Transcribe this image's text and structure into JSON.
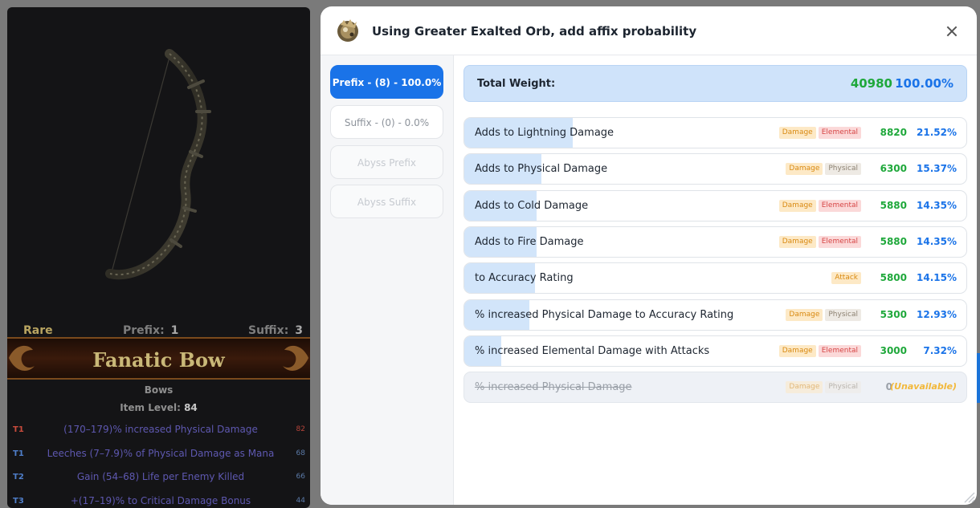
{
  "item": {
    "rarity": "Rare",
    "prefix_label": "Prefix:",
    "prefix_count": "1",
    "suffix_label": "Suffix:",
    "suffix_count": "3",
    "name": "Fanatic Bow",
    "item_class": "Bows",
    "item_level_label": "Item Level:",
    "item_level": "84",
    "mods": [
      {
        "tier": "T1",
        "text": "(170–179)% increased Physical Damage",
        "level": "82",
        "tier_color": "#c94b3c",
        "level_color": "#b5443a"
      },
      {
        "tier": "T1",
        "text": "Leeches (7–7.9)% of Physical Damage as Mana",
        "level": "68",
        "tier_color": "#4f7ec9",
        "level_color": "#5b7aa8"
      },
      {
        "tier": "T2",
        "text": "Gain (54–68) Life per Enemy Killed",
        "level": "66",
        "tier_color": "#4f7ec9",
        "level_color": "#5b7aa8"
      },
      {
        "tier": "T3",
        "text": "+(17–19)% to Critical Damage Bonus",
        "level": "44",
        "tier_color": "#4f7ec9",
        "level_color": "#5b7aa8"
      }
    ]
  },
  "modal": {
    "title": "Using Greater Exalted Orb, add affix probability",
    "icon": "greater-exalted-orb-icon",
    "tabs": [
      {
        "label": "Prefix - (8) - 100.0%",
        "state": "active"
      },
      {
        "label": "Suffix - (0) - 0.0%",
        "state": "normal"
      },
      {
        "label": "Abyss Prefix",
        "state": "disabled"
      },
      {
        "label": "Abyss Suffix",
        "state": "disabled"
      }
    ],
    "total": {
      "label": "Total Weight:",
      "weight": "40980",
      "percent": "100.00%"
    },
    "affixes": [
      {
        "name": "Adds to Lightning Damage",
        "tags": [
          "Damage",
          "Elemental"
        ],
        "weight": "8820",
        "percent": "21.52%",
        "share": 0.2152
      },
      {
        "name": "Adds to Physical Damage",
        "tags": [
          "Damage",
          "Physical"
        ],
        "weight": "6300",
        "percent": "15.37%",
        "share": 0.1537
      },
      {
        "name": "Adds to Cold Damage",
        "tags": [
          "Damage",
          "Elemental"
        ],
        "weight": "5880",
        "percent": "14.35%",
        "share": 0.1435
      },
      {
        "name": "Adds to Fire Damage",
        "tags": [
          "Damage",
          "Elemental"
        ],
        "weight": "5880",
        "percent": "14.35%",
        "share": 0.1435
      },
      {
        "name": "to Accuracy Rating",
        "tags": [
          "Attack"
        ],
        "weight": "5800",
        "percent": "14.15%",
        "share": 0.1415
      },
      {
        "name": "% increased Physical Damage to Accuracy Rating",
        "tags": [
          "Damage",
          "Physical"
        ],
        "weight": "5300",
        "percent": "12.93%",
        "share": 0.1293
      },
      {
        "name": "% increased Elemental Damage with Attacks",
        "tags": [
          "Damage",
          "Elemental"
        ],
        "weight": "3000",
        "percent": "7.32%",
        "share": 0.0732
      },
      {
        "name": "% increased Physical Damage",
        "tags": [
          "Damage",
          "Physical"
        ],
        "weight": "0",
        "percent": "(Unavailable)",
        "share": 0,
        "unavailable": true
      }
    ]
  },
  "colors": {
    "accent": "#1a73e8",
    "weight_green": "#1fa83b",
    "rare_gold": "#b9a561",
    "unavailable_orange": "#f2b83a"
  }
}
